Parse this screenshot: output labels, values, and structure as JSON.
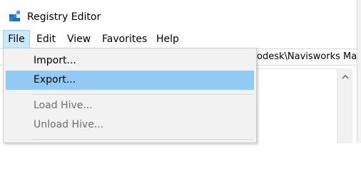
{
  "window": {
    "title": "Registry Editor",
    "icon": "registry-editor-icon"
  },
  "menubar": {
    "items": [
      "File",
      "Edit",
      "View",
      "Favorites",
      "Help"
    ]
  },
  "address": {
    "value": "odesk\\Navisworks Mar"
  },
  "file_menu": {
    "items": [
      {
        "label": "Import...",
        "enabled": true,
        "highlighted": false
      },
      {
        "label": "Export...",
        "enabled": true,
        "highlighted": true
      },
      {
        "label": "Load Hive...",
        "enabled": false,
        "highlighted": false
      },
      {
        "label": "Unload Hive...",
        "enabled": false,
        "highlighted": false
      }
    ]
  },
  "scrollbar": {
    "up_icon": "chevron-up-icon"
  },
  "colors": {
    "menu_highlight": "#91c9f7",
    "menubar_active": "#cce8ff",
    "disabled_text": "#6d6d6d"
  }
}
